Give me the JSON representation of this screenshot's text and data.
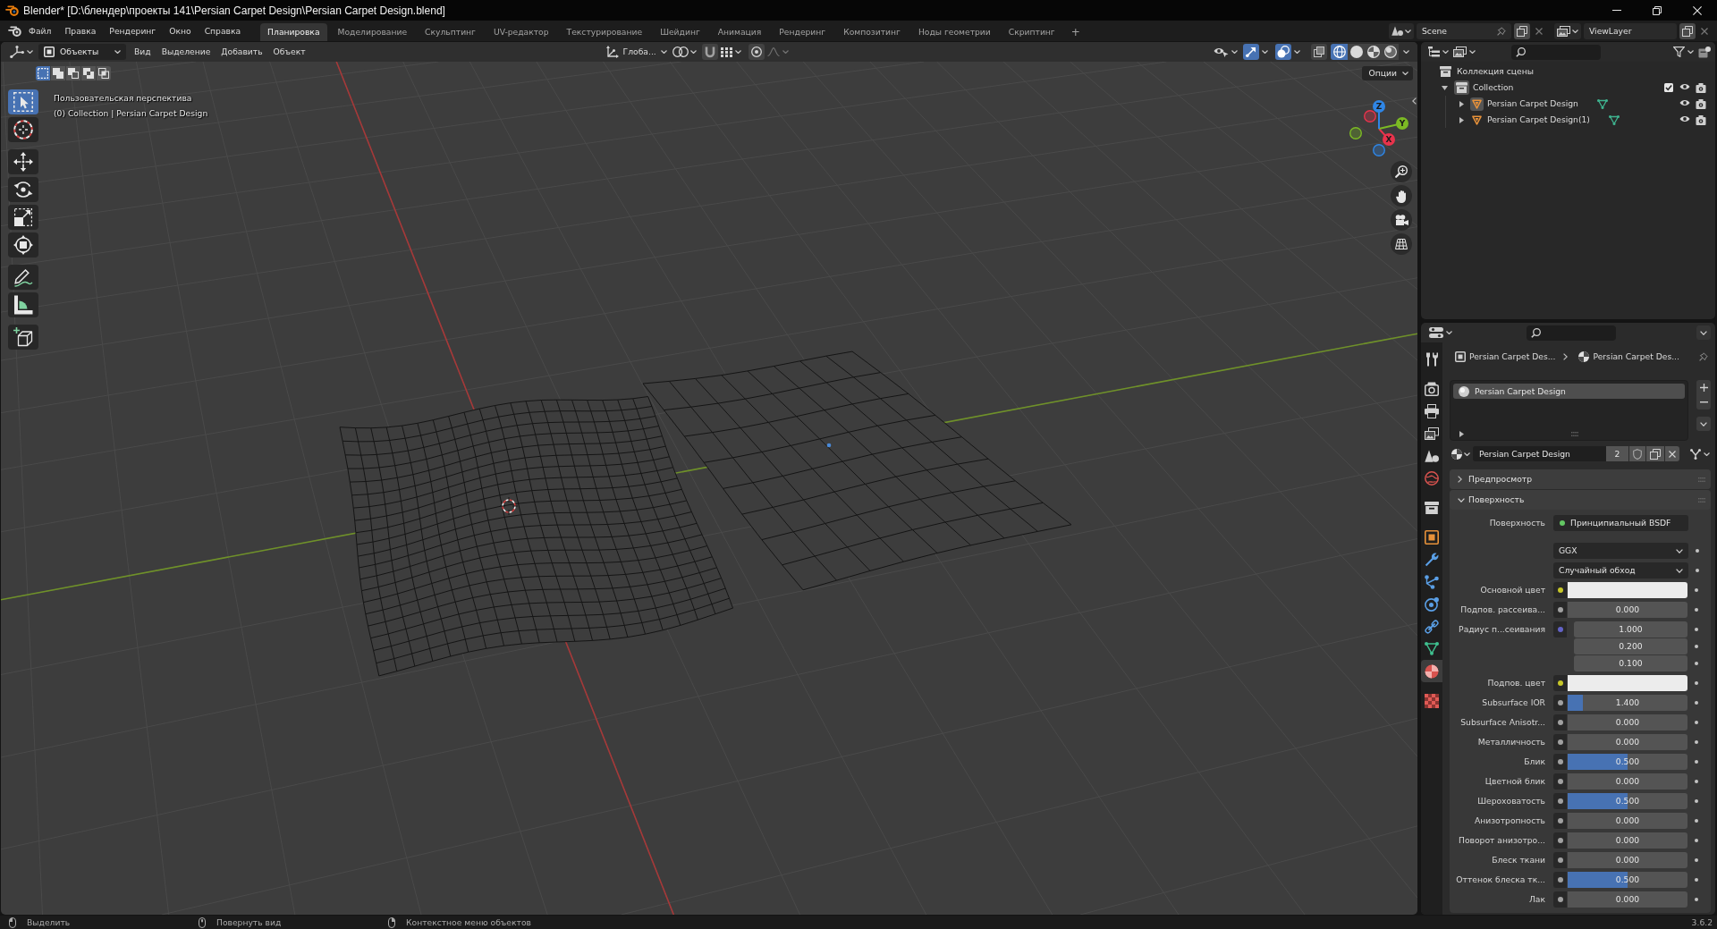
{
  "window": {
    "title": "Blender* [D:\\блендер\\проекты 141\\Persian Carpet Design\\Persian Carpet Design.blend]"
  },
  "menu": [
    "Файл",
    "Правка",
    "Рендеринг",
    "Окно",
    "Справка"
  ],
  "workspaces": [
    {
      "label": "Планировка",
      "selected": true
    },
    {
      "label": "Моделирование",
      "selected": false
    },
    {
      "label": "Скульптинг",
      "selected": false
    },
    {
      "label": "UV-редактор",
      "selected": false
    },
    {
      "label": "Текстурирование",
      "selected": false
    },
    {
      "label": "Шейдинг",
      "selected": false
    },
    {
      "label": "Анимация",
      "selected": false
    },
    {
      "label": "Рендеринг",
      "selected": false
    },
    {
      "label": "Композитинг",
      "selected": false
    },
    {
      "label": "Ноды геометрии",
      "selected": false
    },
    {
      "label": "Скриптинг",
      "selected": false
    }
  ],
  "add_workspace": "+",
  "scene": {
    "value": "Scene"
  },
  "view_layer": {
    "value": "ViewLayer"
  },
  "viewport": {
    "header": {
      "mode": "Объекты",
      "menus": [
        "Вид",
        "Выделение",
        "Добавить",
        "Объект"
      ],
      "orientation": "Глоба...",
      "toggles": [
        {
          "kind": "snap",
          "on": false
        },
        {
          "kind": "proportional",
          "on": false
        },
        {
          "kind": "gizmos",
          "on": true
        },
        {
          "kind": "overlays",
          "on": true
        },
        {
          "kind": "xray",
          "on": false
        }
      ],
      "shading_modes": [
        {
          "kind": "wireframe",
          "selected": true
        },
        {
          "kind": "solid",
          "selected": false
        },
        {
          "kind": "material",
          "selected": false
        },
        {
          "kind": "rendered",
          "selected": false
        }
      ]
    },
    "select_modes": [
      {
        "kind": "new",
        "selected": true
      },
      {
        "kind": "extend",
        "selected": false
      },
      {
        "kind": "subtract",
        "selected": false
      },
      {
        "kind": "invert",
        "selected": false
      },
      {
        "kind": "intersect",
        "selected": false
      }
    ],
    "options": "Опции",
    "tool_groups": [
      [
        {
          "kind": "select_box",
          "selected": true
        },
        {
          "kind": "cursor",
          "selected": false
        }
      ],
      [
        {
          "kind": "move",
          "selected": false
        },
        {
          "kind": "rotate",
          "selected": false
        },
        {
          "kind": "scale",
          "selected": false
        },
        {
          "kind": "transform",
          "selected": false
        }
      ],
      [
        {
          "kind": "annotate",
          "selected": false
        },
        {
          "kind": "measure",
          "selected": false
        }
      ],
      [
        {
          "kind": "add_cube",
          "selected": false
        }
      ]
    ],
    "info": [
      "Пользовательская перспектива",
      "(0) Collection | Persian Carpet Design"
    ],
    "gizmo_axes": [
      {
        "kind": "x",
        "label": "X",
        "color": "#e8334c"
      },
      {
        "kind": "y",
        "label": "Y",
        "color": "#7cba24"
      },
      {
        "kind": "z",
        "label": "Z",
        "color": "#2f86e6"
      }
    ]
  },
  "outliner": {
    "root": "Коллекция сцены",
    "items": [
      {
        "kind": "collection",
        "label": "Collection",
        "expanded": true,
        "active": true,
        "checked": true,
        "children": [
          {
            "kind": "mesh",
            "label": "Persian Carpet Design",
            "expanded": false,
            "active": true
          },
          {
            "kind": "mesh",
            "label": "Persian Carpet Design(1)",
            "expanded": false,
            "active": false
          }
        ]
      }
    ]
  },
  "properties": {
    "tab_groups": [
      [
        {
          "kind": "tool",
          "selected": false
        }
      ],
      [
        {
          "kind": "render",
          "selected": false
        },
        {
          "kind": "output",
          "selected": false
        },
        {
          "kind": "view_layer",
          "selected": false
        },
        {
          "kind": "scene",
          "selected": false
        },
        {
          "kind": "world",
          "selected": false
        }
      ],
      [
        {
          "kind": "collection",
          "selected": false
        }
      ],
      [
        {
          "kind": "object",
          "selected": false
        },
        {
          "kind": "modifiers",
          "selected": false
        },
        {
          "kind": "particles",
          "selected": false
        },
        {
          "kind": "physics",
          "selected": false
        },
        {
          "kind": "constraints",
          "selected": false
        },
        {
          "kind": "data",
          "selected": false
        },
        {
          "kind": "material",
          "selected": true
        }
      ],
      [
        {
          "kind": "texture",
          "selected": false
        }
      ]
    ],
    "breadcrumb": [
      "Persian Carpet Des...",
      "Persian Carpet Des..."
    ],
    "material_slots": [
      {
        "label": "Persian Carpet Design",
        "selected": true
      }
    ],
    "material": {
      "name": "Persian Carpet Design",
      "users": "2"
    },
    "panels": [
      {
        "label": "Предпросмотр",
        "expanded": false
      },
      {
        "label": "Поверхность",
        "expanded": true,
        "rows": [
          {
            "kind": "shader",
            "label": "Поверхность",
            "value": "Принципиальный BSDF"
          },
          {
            "kind": "dropdown",
            "value": "GGX"
          },
          {
            "kind": "dropdown",
            "value": "Случайный обход"
          },
          {
            "kind": "color",
            "label": "Основной цвет",
            "color": "#ececec"
          },
          {
            "kind": "number",
            "label": "Подпов. рассеива...",
            "value": "0.000"
          },
          {
            "kind": "vector",
            "label": "Радиус п...сеивания",
            "values": [
              "1.000",
              "0.200",
              "0.100"
            ]
          },
          {
            "kind": "color",
            "label": "Подпов. цвет",
            "color": "#ececec"
          },
          {
            "kind": "number",
            "label": "Subsurface IOR",
            "value": "1.400",
            "level": 0.13
          },
          {
            "kind": "number",
            "label": "Subsurface Anisotr...",
            "value": "0.000"
          },
          {
            "kind": "number",
            "label": "Металличность",
            "value": "0.000"
          },
          {
            "kind": "number",
            "label": "Блик",
            "value": "0.500",
            "level": 0.5
          },
          {
            "kind": "number",
            "label": "Цветной блик",
            "value": "0.000"
          },
          {
            "kind": "number",
            "label": "Шероховатость",
            "value": "0.500",
            "level": 0.5
          },
          {
            "kind": "number",
            "label": "Анизотропность",
            "value": "0.000"
          },
          {
            "kind": "number",
            "label": "Поворот анизотро...",
            "value": "0.000"
          },
          {
            "kind": "number",
            "label": "Блеск ткани",
            "value": "0.000"
          },
          {
            "kind": "number",
            "label": "Оттенок блеска тк...",
            "value": "0.500",
            "level": 0.5
          },
          {
            "kind": "number",
            "label": "Лак",
            "value": "0.000"
          }
        ]
      }
    ]
  },
  "status_bar": {
    "hints": [
      {
        "kind": "left_click",
        "label": "Выделить"
      },
      {
        "kind": "middle_click",
        "label": "Повернуть вид"
      },
      {
        "kind": "right_click",
        "label": "Контекстное меню объектов"
      }
    ],
    "version": "3.6.2"
  }
}
